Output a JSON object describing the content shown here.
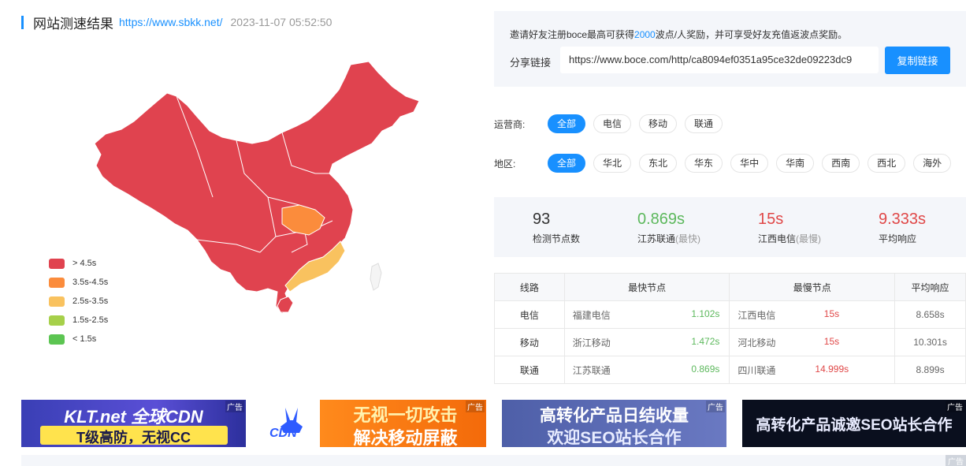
{
  "header": {
    "title": "网站测速结果",
    "url": "https://www.sbkk.net/",
    "timestamp": "2023-11-07 05:52:50"
  },
  "legend": [
    {
      "label": "> 4.5s",
      "color": "#e0434f"
    },
    {
      "label": "3.5s-4.5s",
      "color": "#fb8c3c"
    },
    {
      "label": "2.5s-3.5s",
      "color": "#f9c25f"
    },
    {
      "label": "1.5s-2.5s",
      "color": "#a6d04a"
    },
    {
      "label": "< 1.5s",
      "color": "#5cc552"
    }
  ],
  "invite": {
    "text_before": "邀请好友注册boce最高可获得",
    "highlight": "2000",
    "text_after": "波点/人奖励，并可享受好友充值返波点奖励。",
    "share_label": "分享链接",
    "share_link": "https://www.boce.com/http/ca8094ef0351a95ce32de09223dc9",
    "copy_button": "复制链接"
  },
  "filters": {
    "operator_label": "运营商:",
    "operators": [
      "全部",
      "电信",
      "移动",
      "联通"
    ],
    "region_label": "地区:",
    "regions": [
      "全部",
      "华北",
      "东北",
      "华东",
      "华中",
      "华南",
      "西南",
      "西北",
      "海外"
    ]
  },
  "stats": {
    "nodes_value": "93",
    "nodes_label": "检测节点数",
    "fastest_value": "0.869s",
    "fastest_label": "江苏联通",
    "fastest_note": "(最快)",
    "slowest_value": "15s",
    "slowest_label": "江西电信",
    "slowest_note": "(最慢)",
    "avg_value": "9.333s",
    "avg_label": "平均响应"
  },
  "table": {
    "headers": [
      "线路",
      "最快节点",
      "最慢节点",
      "平均响应"
    ],
    "rows": [
      {
        "line": "电信",
        "fast_node": "福建电信",
        "fast_time": "1.102s",
        "slow_node": "江西电信",
        "slow_time": "15s",
        "avg": "8.658s"
      },
      {
        "line": "移动",
        "fast_node": "浙江移动",
        "fast_time": "1.472s",
        "slow_node": "河北移动",
        "slow_time": "15s",
        "avg": "10.301s"
      },
      {
        "line": "联通",
        "fast_node": "江苏联通",
        "fast_time": "0.869s",
        "slow_node": "四川联通",
        "slow_time": "14.999s",
        "avg": "8.899s"
      }
    ]
  },
  "ads": [
    {
      "line1": "KLT.net 全球CDN",
      "line2": "T级高防，无视CC",
      "tag": "广告"
    },
    {
      "line1": "无视一切攻击",
      "line2": "解决移动屏蔽",
      "logo": "CDN",
      "tag": "广告"
    },
    {
      "line1": "高转化产品日结收量",
      "line2": "欢迎SEO站长合作",
      "tag": "广告"
    },
    {
      "line1": "高转化产品诚邀SEO站长合作",
      "tag": "广告"
    }
  ],
  "bottom_tag": "广告"
}
